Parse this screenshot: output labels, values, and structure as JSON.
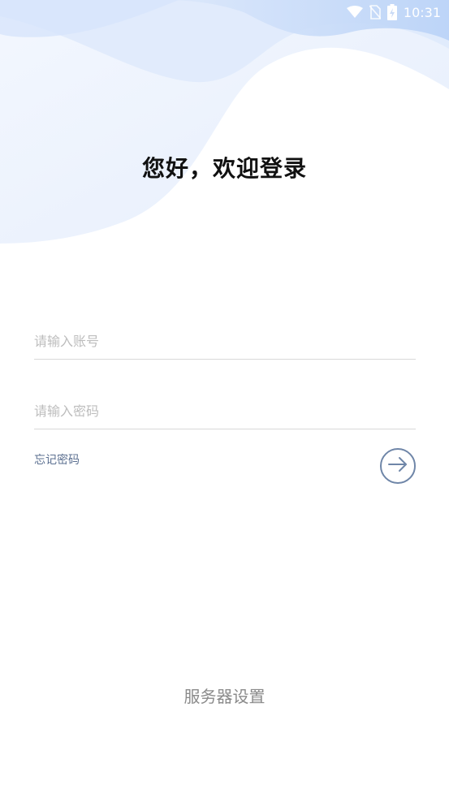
{
  "status_bar": {
    "time": "10:31",
    "icons": [
      "wifi-icon",
      "no-sim-icon",
      "battery-charging-icon"
    ]
  },
  "login": {
    "title": "您好，欢迎登录",
    "account_placeholder": "请输入账号",
    "account_value": "",
    "password_placeholder": "请输入密码",
    "password_value": "",
    "forgot_password_label": "忘记密码",
    "submit_icon": "arrow-right-icon"
  },
  "footer": {
    "server_settings_label": "服务器设置"
  },
  "colors": {
    "wave_light": "#e9f1fd",
    "wave_mid": "#d4e4fb",
    "accent": "#6f86a8",
    "link": "#5c7091",
    "placeholder": "#bdbdbd",
    "divider": "#d9d9d9"
  }
}
